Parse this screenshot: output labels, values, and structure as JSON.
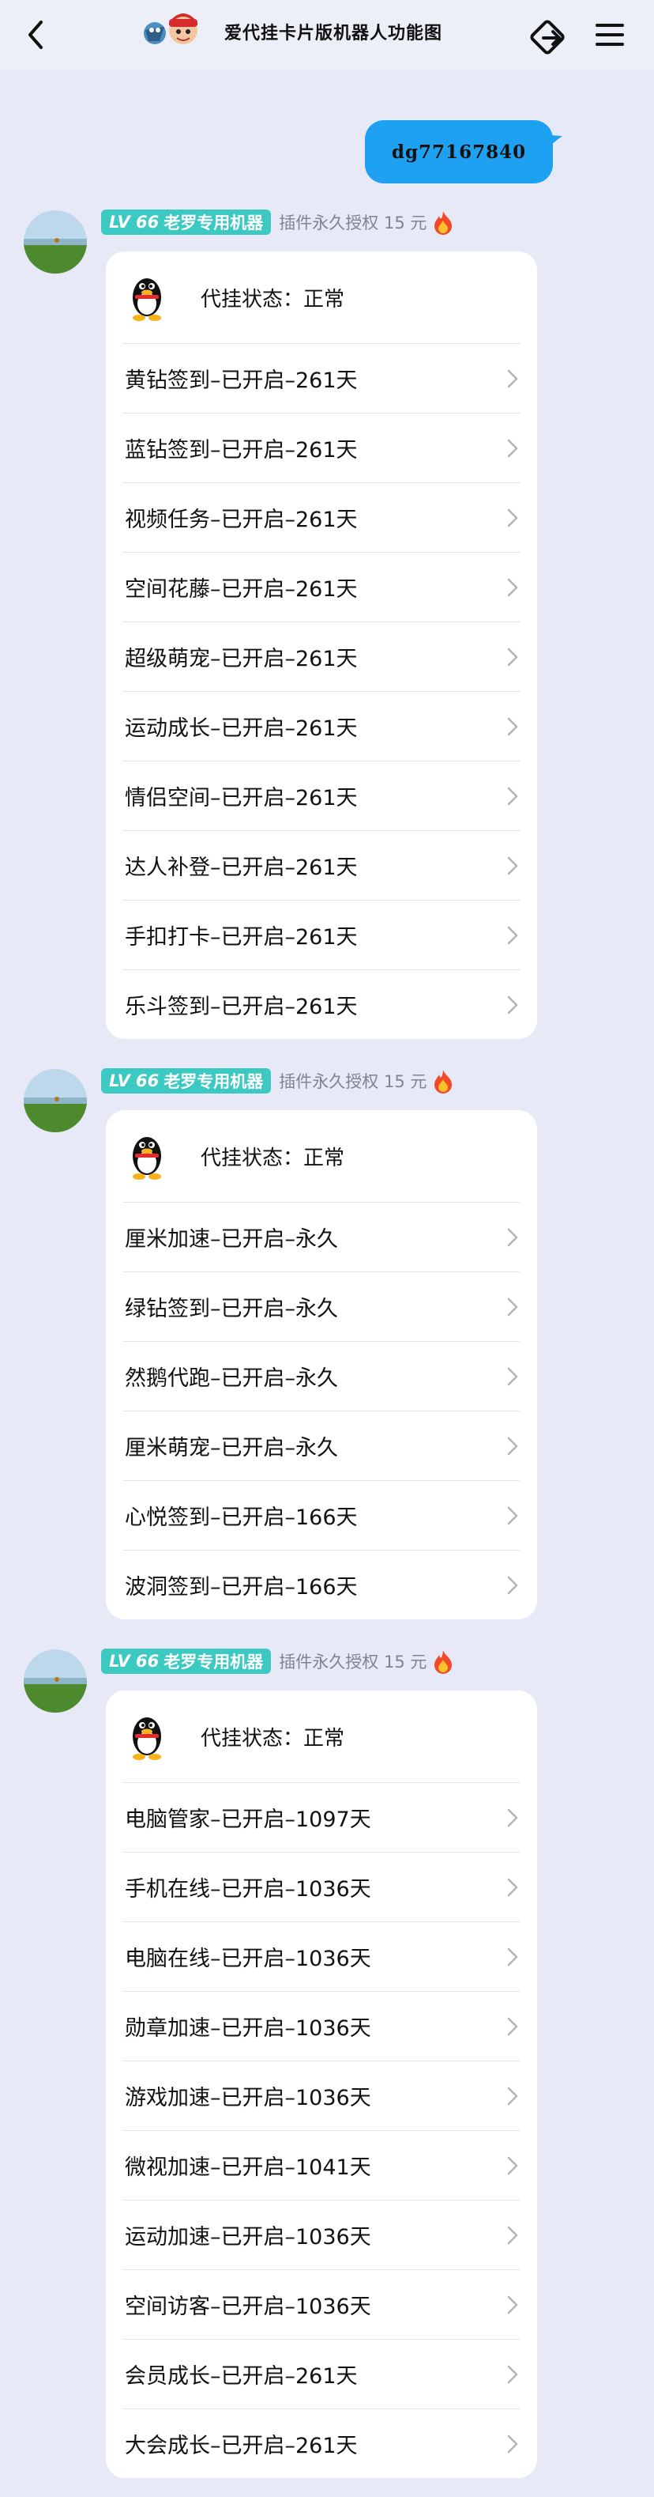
{
  "header": {
    "title": "爱代挂卡片版机器人功能图",
    "icons": [
      "back-icon",
      "logo-icon",
      "share-icon",
      "menu-icon"
    ]
  },
  "sent_message": {
    "text": "dg77167840",
    "bubble_color": "#1fa1f2"
  },
  "messages": [
    {
      "sender": {
        "level": "LV 66",
        "name": "老罗专用机器",
        "auth": "插件永久授权 15 元"
      },
      "status_label": "代挂状态：正常",
      "items": [
        "黄钻签到–已开启–261天",
        "蓝钻签到–已开启–261天",
        "视频任务–已开启–261天",
        "空间花藤–已开启–261天",
        "超级萌宠–已开启–261天",
        "运动成长–已开启–261天",
        "情侣空间–已开启–261天",
        "达人补登–已开启–261天",
        "手扣打卡–已开启–261天",
        "乐斗签到–已开启–261天"
      ]
    },
    {
      "sender": {
        "level": "LV 66",
        "name": "老罗专用机器",
        "auth": "插件永久授权 15 元"
      },
      "status_label": "代挂状态：正常",
      "items": [
        "厘米加速–已开启–永久",
        "绿钻签到–已开启–永久",
        "然鹅代跑–已开启–永久",
        "厘米萌宠–已开启–永久",
        "心悦签到–已开启–166天",
        "波洞签到–已开启–166天"
      ]
    },
    {
      "sender": {
        "level": "LV 66",
        "name": "老罗专用机器",
        "auth": "插件永久授权 15 元"
      },
      "status_label": "代挂状态：正常",
      "items": [
        "电脑管家–已开启–1097天",
        "手机在线–已开启–1036天",
        "电脑在线–已开启–1036天",
        "勋章加速–已开启–1036天",
        "游戏加速–已开启–1036天",
        "微视加速–已开启–1041天",
        "运动加速–已开启–1036天",
        "空间访客–已开启–1036天",
        "会员成长–已开启–261天",
        "大会成长–已开启–261天"
      ]
    }
  ],
  "colors": {
    "background": "#e7e9f6",
    "level_badge": "#3cc9c2",
    "card": "#ffffff"
  }
}
